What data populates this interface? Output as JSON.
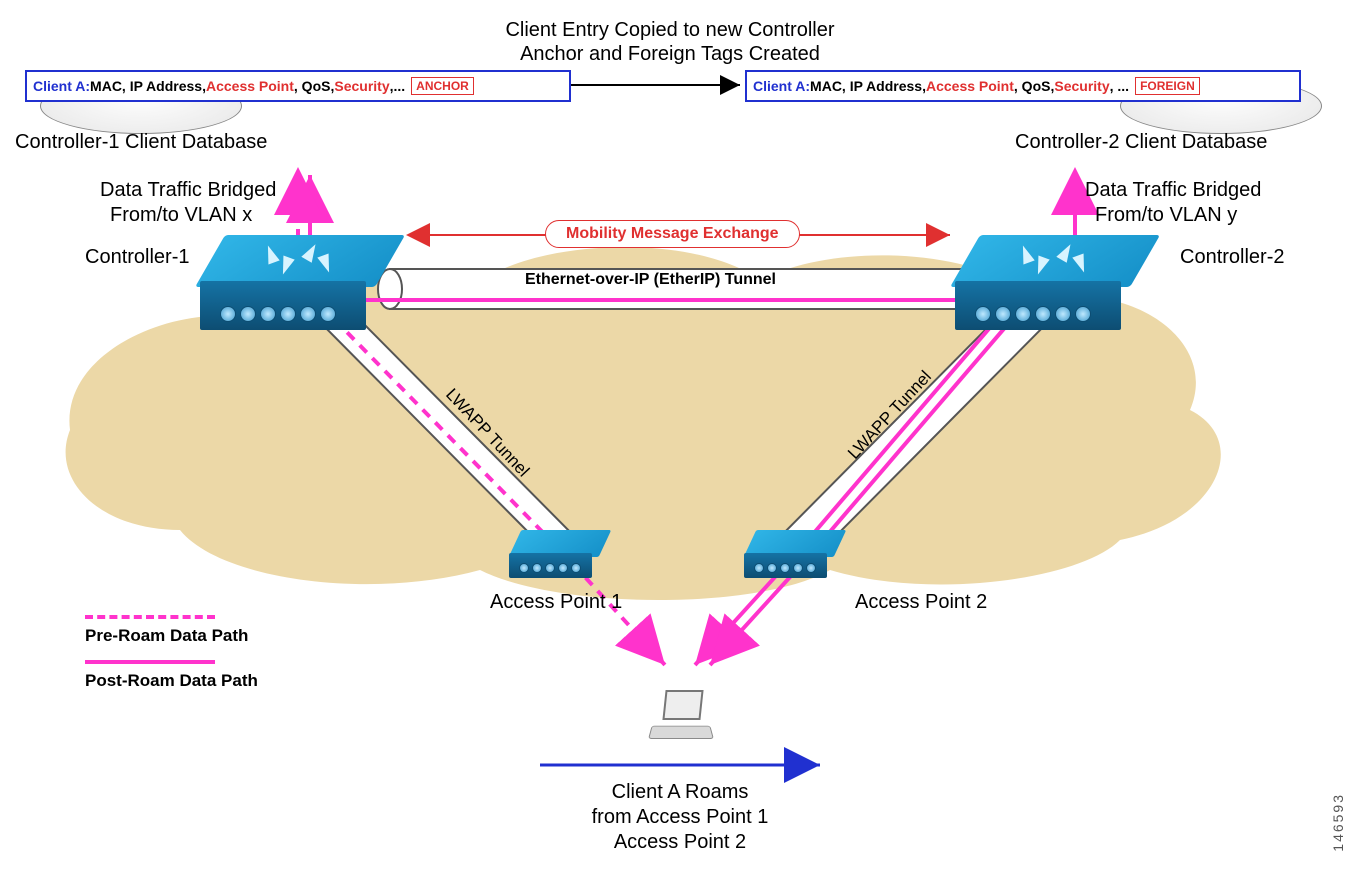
{
  "header": {
    "line1": "Client Entry Copied to new Controller",
    "line2": "Anchor and Foreign Tags Created"
  },
  "entryLeft": {
    "client": "Client A:",
    "fields_black1": " MAC, IP Address, ",
    "field_red1": "Access Point",
    "fields_black2": ", QoS, ",
    "field_red2": "Security",
    "ellipsis": ",...",
    "tag": "ANCHOR"
  },
  "entryRight": {
    "client": "Client A:",
    "fields_black1": " MAC, IP Address, ",
    "field_red1": "Access Point",
    "fields_black2": ", QoS, ",
    "field_red2": "Security",
    "ellipsis": ", ...",
    "tag": "FOREIGN"
  },
  "dbLabels": {
    "left": "Controller-1 Client Database",
    "right": "Controller-2 Client Database"
  },
  "traffic": {
    "left_line1": "Data Traffic Bridged",
    "left_line2": "From/to VLAN x",
    "right_line1": "Data Traffic Bridged",
    "right_line2": "From/to VLAN y"
  },
  "controllers": {
    "left": "Controller-1",
    "right": "Controller-2"
  },
  "mobility": "Mobility Message Exchange",
  "etherip": "Ethernet-over-IP (EtherIP) Tunnel",
  "lwapp": "LWAPP Tunnel",
  "aps": {
    "left": "Access Point 1",
    "right": "Access Point 2"
  },
  "legend": {
    "pre": "Pre-Roam Data Path",
    "post": "Post-Roam Data Path"
  },
  "client": {
    "line1": "Client A Roams",
    "line2": "from Access Point 1",
    "line3": "Access Point 2"
  },
  "figureId": "146593"
}
